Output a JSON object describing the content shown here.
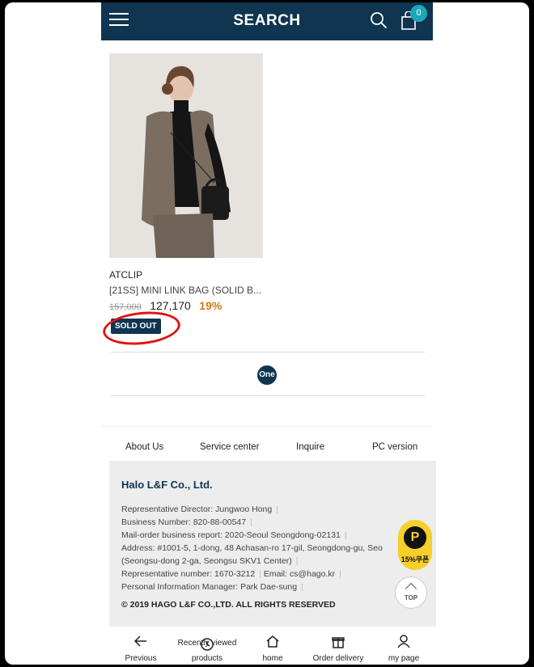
{
  "header": {
    "title": "SEARCH",
    "cart_count": "0"
  },
  "product": {
    "brand": "ATCLIP",
    "name": "[21SS] MINI LINK BAG (SOLID B...",
    "original_price": "157,000",
    "sale_price": "127,170",
    "discount": "19%",
    "status_badge": "SOLD OUT"
  },
  "pagination": {
    "current": "One"
  },
  "footer_links": [
    "About Us",
    "Service center",
    "Inquire",
    "PC version"
  ],
  "company": {
    "name": "Halo L&F Co., Ltd.",
    "lines": [
      "Representative Director: Jungwoo Hong",
      "Business Number: 820-88-00547",
      "Mail-order business report: 2020-Seoul Seongdong-02131",
      "Address: #1001-5, 1-dong, 48 Achasan-ro 17-gil, Seongdong-gu, Seo",
      "(Seongsu-dong 2-ga, Seongsu SKV1 Center)",
      "Representative number: 1670-3212",
      "Email: cs@hago.kr",
      "Personal Information Manager: Park Dae-sung"
    ],
    "copyright": "© 2019 HAGO L&F CO.,LTD. ALL RIGHTS RESERVED"
  },
  "floating": {
    "coupon_symbol": "P",
    "coupon_label": "15%쿠폰",
    "top_label": "TOP"
  },
  "bottom_nav": {
    "previous": "Previous",
    "recent_top": "Recently viewed",
    "recent_bottom": "products",
    "home": "home",
    "order": "Order delivery",
    "mypage": "my page"
  },
  "colors": {
    "brand_navy": "#0f3550",
    "badge_teal": "#1aa8b8",
    "discount_orange": "#c77a16",
    "coupon_yellow": "#f5cf2a",
    "annotation_red": "#e01414"
  },
  "icons": [
    "hamburger-icon",
    "search-icon",
    "cart-icon",
    "arrow-left-icon",
    "recent-icon",
    "home-icon",
    "gift-box-icon",
    "user-icon",
    "chevron-up-icon"
  ]
}
